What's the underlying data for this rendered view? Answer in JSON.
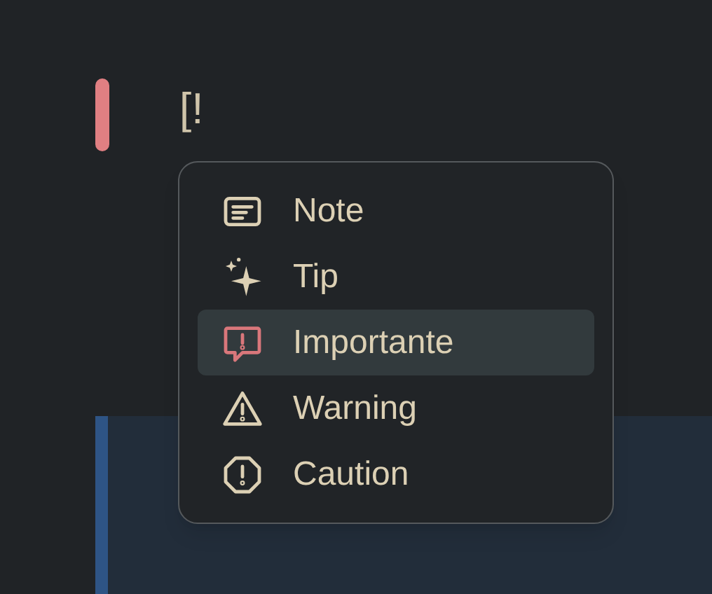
{
  "editor": {
    "line_text": "[!"
  },
  "menu": {
    "items": [
      {
        "kind": "note",
        "label": "Note",
        "selected": false
      },
      {
        "kind": "tip",
        "label": "Tip",
        "selected": false
      },
      {
        "kind": "important",
        "label": "Importante",
        "selected": true
      },
      {
        "kind": "warning",
        "label": "Warning",
        "selected": false
      },
      {
        "kind": "caution",
        "label": "Caution",
        "selected": false
      }
    ]
  }
}
